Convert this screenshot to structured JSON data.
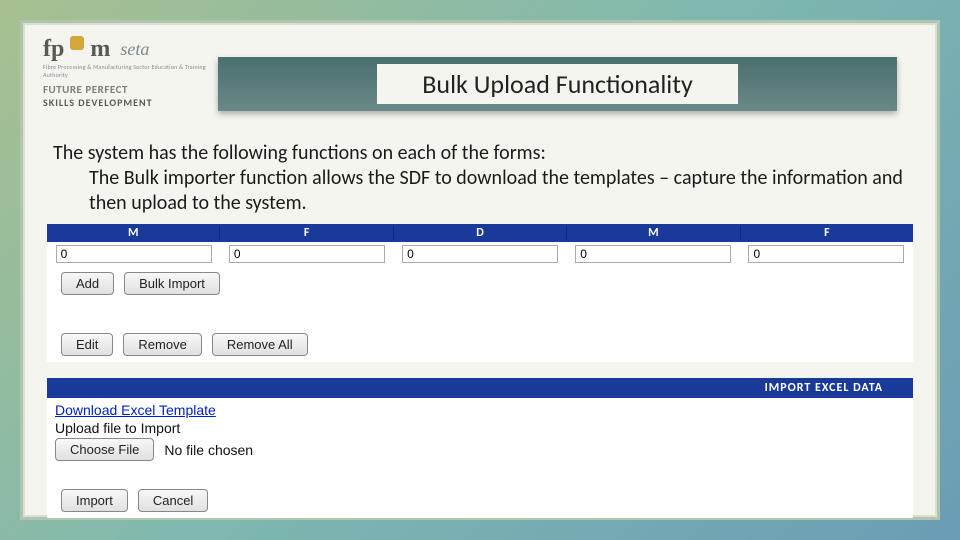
{
  "header": {
    "logo_fp": "fp",
    "logo_m": "m",
    "logo_seta": "seta",
    "tagline_tiny": "Fibre Processing & Manufacturing Sector Education & Training Authority",
    "future_perfect": "FUTURE PERFECT",
    "skills_dev": "SKILLS DEVELOPMENT",
    "title": "Bulk Upload Functionality"
  },
  "body": {
    "line1": "The system has the following functions on each of the forms:",
    "line2": "The Bulk importer function allows the SDF to download the templates – capture the information and then upload to the system."
  },
  "grid": {
    "headers": [
      "M",
      "F",
      "D",
      "M",
      "F"
    ],
    "values": [
      "0",
      "0",
      "0",
      "0",
      "0"
    ]
  },
  "buttons": {
    "add": "Add",
    "bulk_import": "Bulk Import",
    "edit": "Edit",
    "remove": "Remove",
    "remove_all": "Remove All",
    "choose_file": "Choose File",
    "import": "Import",
    "cancel": "Cancel"
  },
  "import_panel": {
    "header": "IMPORT EXCEL DATA",
    "download_link": "Download Excel Template",
    "upload_label": "Upload file to Import",
    "no_file": "No file chosen"
  }
}
